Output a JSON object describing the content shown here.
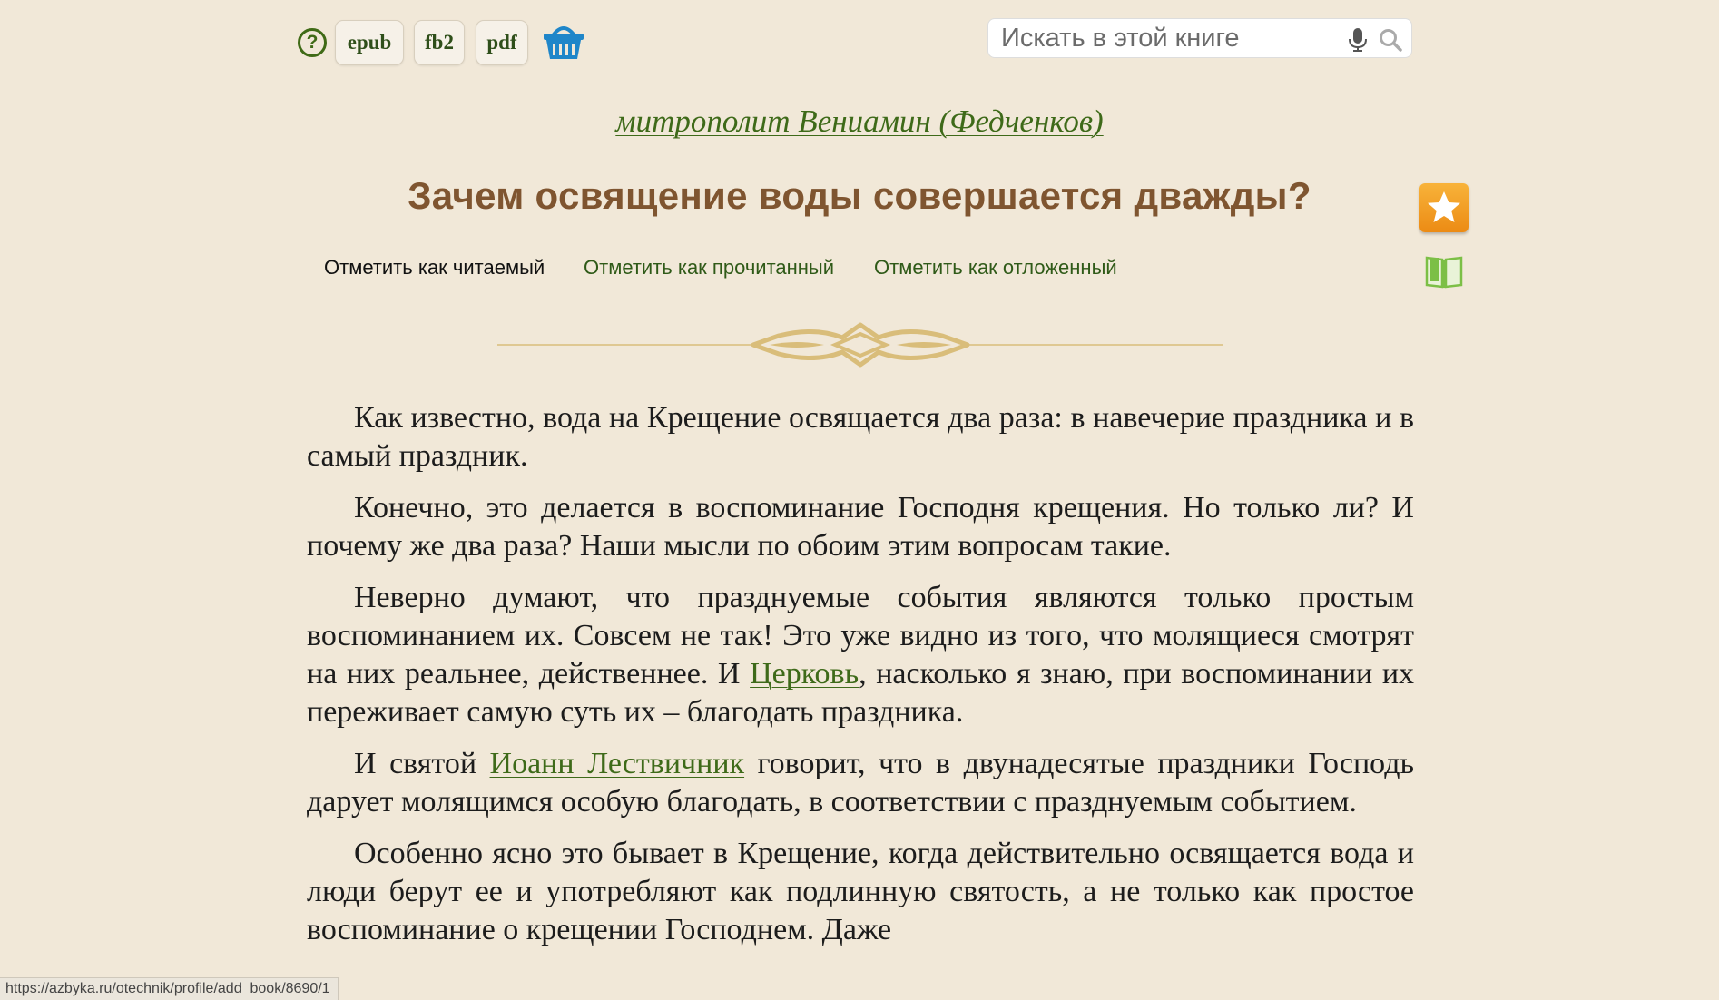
{
  "toolbar": {
    "help_label": "?",
    "formats": [
      "epub",
      "fb2",
      "pdf"
    ]
  },
  "search": {
    "placeholder": "Искать в этой книге"
  },
  "author": "митрополит Вениамин (Федченков)",
  "title": "Зачем освящение воды совершается дважды?",
  "marks": {
    "reading": "Отметить как читаемый",
    "read": "Отметить как прочитанный",
    "postponed": "Отметить как отложенный"
  },
  "paragraphs": {
    "p1": "Как известно, вода на Крещение освящается два раза: в навечерие праздника и в самый праздник.",
    "p2": "Конечно, это делается в воспоминание Господня крещения. Но только ли? И почему же два раза? Наши мысли по обоим этим вопросам такие.",
    "p3_a": "Неверно думают, что празднуемые события являются только простым воспоминанием их. Совсем не так! Это уже видно из того, что молящиеся смотрят на них реальнее, действеннее. И ",
    "p3_link": "Церковь",
    "p3_b": ", насколько я знаю, при воспоминании их переживает самую суть их – благодать праздника.",
    "p4_a": "И святой ",
    "p4_link": "Иоанн Лествичник",
    "p4_b": " говорит, что в двунадесятые праздники Господь дарует молящимся особую благодать, в соответствии с празднуемым событием.",
    "p5": "Особенно ясно это бывает в Крещение, когда действительно освящается вода и люди берут ее и употребляют как подлинную святость, а не только как простое воспоминание о крещении Господнем. Даже"
  },
  "status_url": "https://azbyka.ru/otechnik/profile/add_book/8690/1",
  "colors": {
    "background": "#f1e8d8",
    "link_green": "#3e6a19",
    "title_brown": "#7f5530",
    "favorite_orange": "#f0991f",
    "basket_blue": "#1f86c9",
    "ornament_gold": "#d9bd7a"
  },
  "icons": [
    "help-icon",
    "basket-icon",
    "microphone-icon",
    "search-icon",
    "star-icon",
    "open-book-icon",
    "ornament-divider"
  ]
}
